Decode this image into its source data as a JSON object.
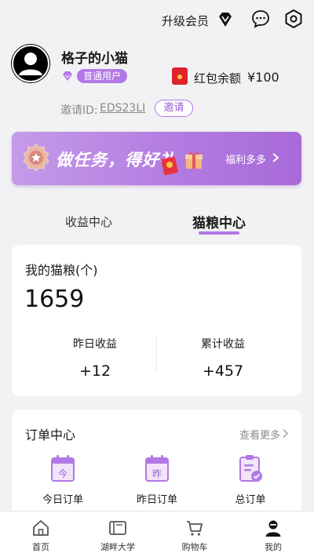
{
  "header": {
    "upgrade_label": "升级会员"
  },
  "profile": {
    "username": "格子的小猫",
    "member_badge": "普通用户",
    "red_packet_label": "红包余额",
    "red_packet_value": "¥100",
    "invite_label": "邀请ID:",
    "invite_code": "EDS23LI",
    "invite_button": "邀请"
  },
  "banner": {
    "title": "做任务，得好礼",
    "more_label": "福利多多"
  },
  "tabs": [
    {
      "label": "收益中心",
      "active": false
    },
    {
      "label": "猫粮中心",
      "active": true
    }
  ],
  "grain": {
    "title": "我的猫粮(个)",
    "total": "1659",
    "stats": [
      {
        "label": "昨日收益",
        "value": "+12"
      },
      {
        "label": "累计收益",
        "value": "+457"
      }
    ]
  },
  "orders": {
    "title": "订单中心",
    "more_label": "查看更多",
    "items": [
      {
        "label": "今日订单",
        "icon_text": "今"
      },
      {
        "label": "昨日订单",
        "icon_text": "昨"
      },
      {
        "label": "总订单",
        "icon_text": ""
      }
    ]
  },
  "bottom_nav": [
    {
      "label": "首页",
      "icon": "home-icon"
    },
    {
      "label": "湖畔大学",
      "icon": "book-icon"
    },
    {
      "label": "购物车",
      "icon": "cart-icon"
    },
    {
      "label": "我的",
      "icon": "profile-icon",
      "active": true
    }
  ],
  "colors": {
    "accent": "#b178e6",
    "red_packet": "#e0222b"
  }
}
